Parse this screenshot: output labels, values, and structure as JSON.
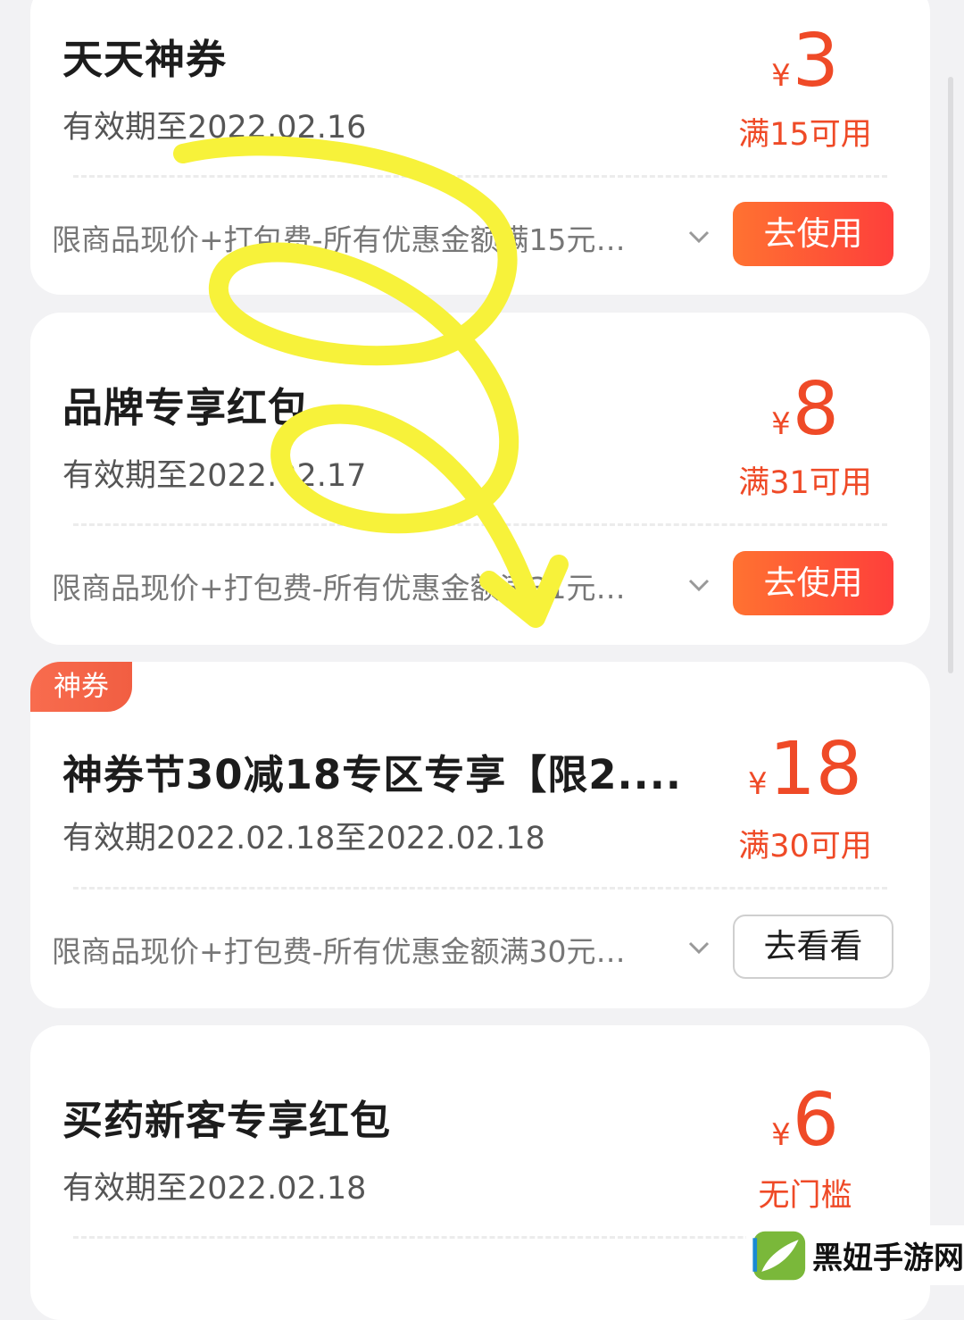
{
  "coupons": [
    {
      "title": "天天神券",
      "validity": "有效期至2022.02.16",
      "currency": "¥",
      "amount": "3",
      "condition": "满15可用",
      "description": "限商品现价+打包费-所有优惠金额满15元使...",
      "button_label": "去使用"
    },
    {
      "title": "品牌专享红包",
      "validity": "有效期至2022.02.17",
      "currency": "¥",
      "amount": "8",
      "condition": "满31可用",
      "description": "限商品现价+打包费-所有优惠金额满31元使...",
      "button_label": "去使用"
    },
    {
      "badge": "神券",
      "title": "神券节30减18专区专享【限2....",
      "validity": "有效期2022.02.18至2022.02.18",
      "currency": "¥",
      "amount": "18",
      "condition": "满30可用",
      "description": "限商品现价+打包费-所有优惠金额满30元使...",
      "button_label": "去看看"
    },
    {
      "title": "买药新客专享红包",
      "validity": "有效期至2022.02.18",
      "currency": "¥",
      "amount": "6",
      "condition": "无门槛"
    }
  ],
  "watermark": {
    "text": "黑妞手游网"
  },
  "colors": {
    "accent": "#ef4a27",
    "button_gradient_start": "#ff7231",
    "button_gradient_end": "#fe3f3b",
    "annotation_yellow": "#f7f23a"
  }
}
